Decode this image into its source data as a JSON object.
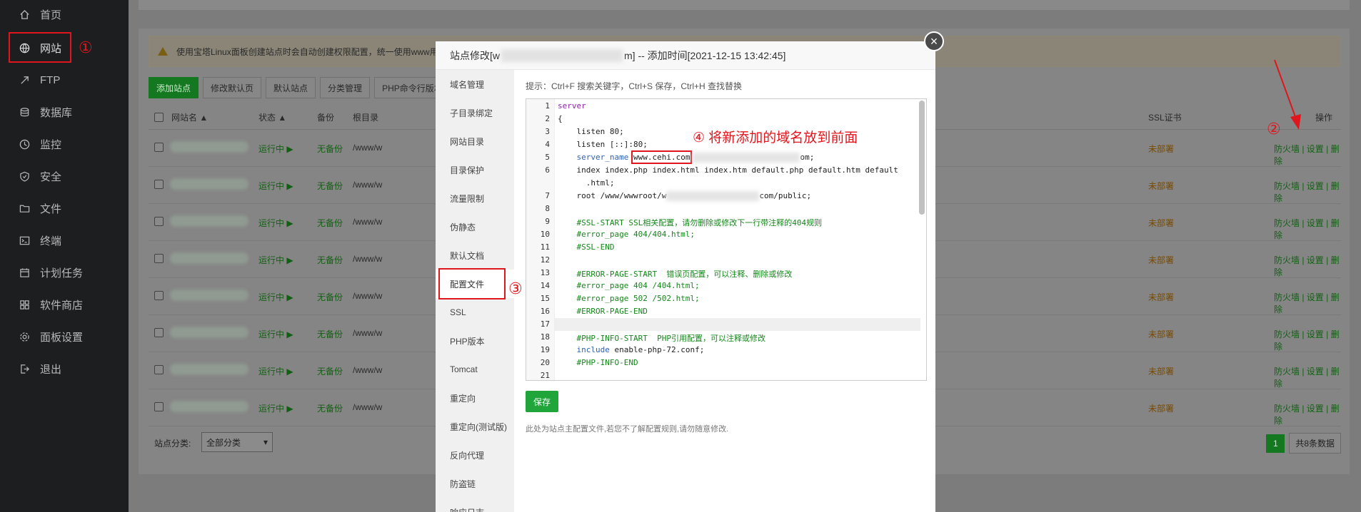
{
  "sidebar": {
    "items": [
      {
        "label": "首页",
        "icon": "home-icon"
      },
      {
        "label": "网站",
        "icon": "globe-icon"
      },
      {
        "label": "FTP",
        "icon": "ftp-icon"
      },
      {
        "label": "数据库",
        "icon": "database-icon"
      },
      {
        "label": "监控",
        "icon": "monitor-icon"
      },
      {
        "label": "安全",
        "icon": "shield-icon"
      },
      {
        "label": "文件",
        "icon": "folder-icon"
      },
      {
        "label": "终端",
        "icon": "terminal-icon"
      },
      {
        "label": "计划任务",
        "icon": "calendar-icon"
      },
      {
        "label": "软件商店",
        "icon": "store-icon"
      },
      {
        "label": "面板设置",
        "icon": "settings-icon"
      },
      {
        "label": "退出",
        "icon": "logout-icon"
      }
    ]
  },
  "annotations": {
    "a1": "①",
    "a2": "②",
    "a3": "③",
    "a4": "④ 将新添加的域名放到前面"
  },
  "notice": "使用宝塔Linux面板创建站点时会自动创建权限配置，统一使用www用",
  "toolbar": {
    "add": "添加站点",
    "modify_default": "修改默认页",
    "default_site": "默认站点",
    "category": "分类管理",
    "php_cli": "PHP命令行版本"
  },
  "table": {
    "headers": {
      "name": "网站名 ▲",
      "status": "状态 ▲",
      "backup": "备份",
      "root": "根目录",
      "ssl": "SSL证书",
      "ops": "操作"
    },
    "rows": [
      {
        "status": "运行中 ▶",
        "backup": "无备份",
        "root": "/www/w",
        "ssl": "未部署",
        "ops": "防火墙 | 设置 | 删除"
      },
      {
        "status": "运行中 ▶",
        "backup": "无备份",
        "root": "/www/w",
        "ssl": "未部署",
        "ops": "防火墙 | 设置 | 删除"
      },
      {
        "status": "运行中 ▶",
        "backup": "无备份",
        "root": "/www/w",
        "ssl": "未部署",
        "ops": "防火墙 | 设置 | 删除"
      },
      {
        "status": "运行中 ▶",
        "backup": "无备份",
        "root": "/www/w",
        "ssl": "未部署",
        "ops": "防火墙 | 设置 | 删除"
      },
      {
        "status": "运行中 ▶",
        "backup": "无备份",
        "root": "/www/w",
        "ssl": "未部署",
        "ops": "防火墙 | 设置 | 删除"
      },
      {
        "status": "运行中 ▶",
        "backup": "无备份",
        "root": "/www/w",
        "ssl": "未部署",
        "ops": "防火墙 | 设置 | 删除"
      },
      {
        "status": "运行中 ▶",
        "backup": "无备份",
        "root": "/www/w",
        "ssl": "未部署",
        "ops": "防火墙 | 设置 | 删除"
      },
      {
        "status": "运行中 ▶",
        "backup": "无备份",
        "root": "/www/w",
        "ssl": "未部署",
        "ops": "防火墙 | 设置 | 删除"
      }
    ]
  },
  "bottom": {
    "category_label": "站点分类:",
    "category_value": "全部分类",
    "page": "1",
    "total": "共8条数据"
  },
  "modal": {
    "title_prefix": "站点修改[w",
    "title_suffix": "m] -- 添加时间[2021-12-15 13:42:45]",
    "close": "×",
    "menu": [
      "域名管理",
      "子目录绑定",
      "网站目录",
      "目录保护",
      "流量限制",
      "伪静态",
      "默认文档",
      "配置文件",
      "SSL",
      "PHP版本",
      "Tomcat",
      "重定向",
      "重定向(测试版)",
      "反向代理",
      "防盗链",
      "响应日志"
    ],
    "tip": "提示：Ctrl+F 搜索关键字，Ctrl+S 保存，Ctrl+H 查找替换",
    "save": "保存",
    "note": "此处为站点主配置文件,若您不了解配置规则,请勿随意修改.",
    "code": {
      "l1": "server",
      "l2": "{",
      "l3": "    listen 80;",
      "l4": "    listen [::]:80;",
      "l5a": "    server_name ",
      "l5b": "www.cehi.com",
      "l5c": "om;",
      "l6": "    index index.php index.html index.htm default.php default.htm default",
      "l6b": "      .html;",
      "l7a": "    root /www/wwwroot/w",
      "l7b": "com/public;",
      "l9": "    #SSL-START SSL相关配置，请勿删除或修改下一行带注释的404规则",
      "l10": "    #error_page 404/404.html;",
      "l11": "    #SSL-END",
      "l13": "    #ERROR-PAGE-START  错误页配置，可以注释、删除或修改",
      "l14": "    #error_page 404 /404.html;",
      "l15": "    #error_page 502 /502.html;",
      "l16": "    #ERROR-PAGE-END",
      "l18": "    #PHP-INFO-START  PHP引用配置，可以注释或修改",
      "l19a": "    include",
      "l19b": " enable-php-72.conf;",
      "l20": "    #PHP-INFO-END"
    },
    "line_numbers": [
      "1",
      "2",
      "3",
      "4",
      "5",
      "6",
      "",
      "7",
      "8",
      "9",
      "10",
      "11",
      "12",
      "13",
      "14",
      "15",
      "16",
      "17",
      "18",
      "19",
      "20",
      "21"
    ]
  }
}
